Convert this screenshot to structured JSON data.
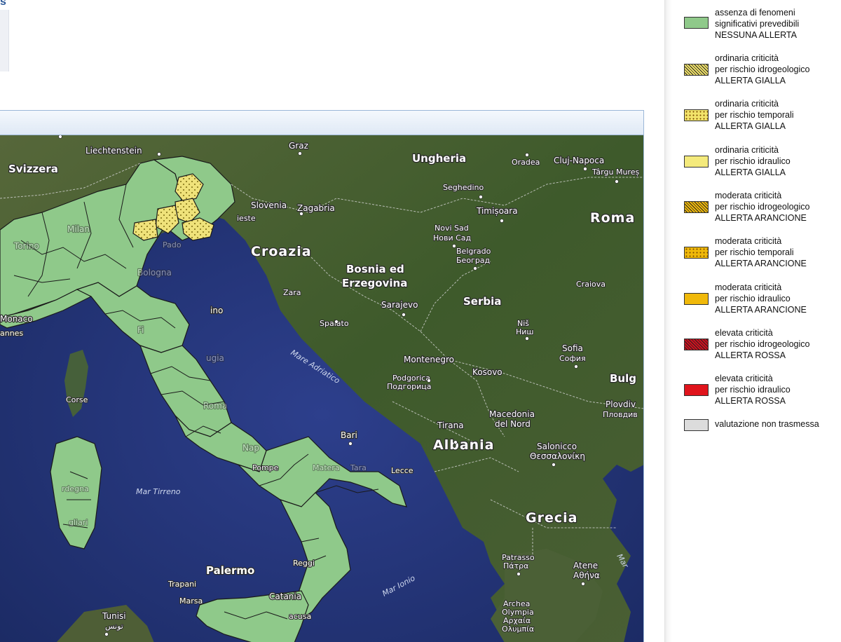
{
  "top": {
    "glyph": "s"
  },
  "legend": {
    "items": [
      {
        "lines": [
          "assenza di fenomeni",
          "significativi prevedibili",
          "NESSUNA ALLERTA"
        ],
        "color": "#8fc98a",
        "pattern": "solid"
      },
      {
        "lines": [
          "ordinaria criticità",
          "per rischio idrogeologico",
          "ALLERTA GIALLA"
        ],
        "color": "#f2e36a",
        "pattern": "hatch"
      },
      {
        "lines": [
          "ordinaria criticità",
          "per rischio temporali",
          "ALLERTA GIALLA"
        ],
        "color": "#f2e36a",
        "pattern": "dots"
      },
      {
        "lines": [
          "ordinaria criticità",
          "per rischio idraulico",
          "ALLERTA GIALLA"
        ],
        "color": "#f4ea7c",
        "pattern": "solid"
      },
      {
        "lines": [
          "moderata criticità",
          "per rischio idrogeologico",
          "ALLERTA ARANCIONE"
        ],
        "color": "#f0b90a",
        "pattern": "hatch"
      },
      {
        "lines": [
          "moderata criticità",
          "per rischio temporali",
          "ALLERTA ARANCIONE"
        ],
        "color": "#f0b90a",
        "pattern": "dots"
      },
      {
        "lines": [
          "moderata criticità",
          "per rischio idraulico",
          "ALLERTA ARANCIONE"
        ],
        "color": "#f0b90a",
        "pattern": "solid"
      },
      {
        "lines": [
          "elevata criticità",
          "per rischio idrogeologico",
          "ALLERTA ROSSA"
        ],
        "color": "#d0101e",
        "pattern": "hatch"
      },
      {
        "lines": [
          "elevata criticità",
          "per rischio idraulico",
          "ALLERTA ROSSA"
        ],
        "color": "#e0141c",
        "pattern": "solid"
      },
      {
        "lines": [
          "valutazione non trasmessa"
        ],
        "color": "#dcdcdc",
        "pattern": "solid"
      }
    ]
  },
  "map": {
    "colors": {
      "land": "#3f5a2e",
      "sea": "#23347a",
      "green_zone": "#8fc98a",
      "yellow_zone": "#efe27a"
    },
    "labels": {
      "svizzera": "Svizzera",
      "liechtenstein": "Liechtenstein",
      "graz": "Graz",
      "ungheria": "Ungheria",
      "oradea": "Oradea",
      "cluj": "Cluj-Napoca",
      "targu": "Târgu Mureș",
      "slovenia": "Slovenia",
      "zagabria": "Zagabria",
      "trieste": "ieste",
      "seghedino": "Seghedino",
      "timisoara": "Timișoara",
      "roma_country": "Roma",
      "croazia": "Croazia",
      "novi_sad": "Novi Sad",
      "novi_sad_cyr": "Нови Сад",
      "belgrado": "Belgrado",
      "belgrado_cyr": "Београд",
      "bosnia": "Bosnia ed",
      "erzegovina": "Erzegovina",
      "zara": "Zara",
      "sarajevo": "Sarajevo",
      "serbia": "Serbia",
      "craiova": "Craiova",
      "monaco": "Monaco",
      "cannes": "annes",
      "spalato": "Spalato",
      "nis": "Niš",
      "nis_cyr": "Ниш",
      "mare_adriatico": "Mare Adriatico",
      "montenegro": "Montenegro",
      "sofia": "Sofia",
      "sofia_cyr": "София",
      "podgorica": "Podgorica",
      "podgorica_cyr": "Подгорица",
      "kosovo": "Kosovo",
      "bulg": "Bulg",
      "corse": "Corse",
      "plovdiv": "Plovdiv",
      "plovdiv_cyr": "Пловдив",
      "macedonia": "Macedonia",
      "del_nord": "del Nord",
      "tirana": "Tirana",
      "albania": "Albania",
      "salonicco": "Salonicco",
      "salonicco_gr": "Θεσσαλονίκη",
      "bari": "Bari",
      "pompei": "Pompe",
      "lecce": "Lecce",
      "mar_tirreno": "Mar Tirreno",
      "grecia": "Grecia",
      "palermo": "Palermo",
      "atene": "Atene",
      "atene_gr": "Αθήνα",
      "patrasso": "Patrasso",
      "patrasso_gr": "Πάτρα",
      "trapani": "Trapani",
      "marsala": "Marsa",
      "reggio": "Reggi",
      "mar_ionio": "Mar Ionio",
      "catania": "Catania",
      "siracusa": "acusa",
      "tunisi": "Tunisi",
      "tunisi_ar": "تونس",
      "archea": "Archea",
      "olympia": "Olympia",
      "archea_gr": "Αρχαία",
      "olympia_gr": "Ολυμπία",
      "san_marino": "ino",
      "milano": "Milan",
      "torino": "Torino",
      "padova": "Pado",
      "bologna": "Bologna",
      "firenze": "Fi",
      "perugia": "ugia",
      "roma_city": "Roma",
      "napoli": "Nap",
      "matera": "Matera",
      "taranto": "Tara",
      "sardegna": "rdegna",
      "cagliari": "gliari",
      "mar_gr": "Mar"
    }
  }
}
